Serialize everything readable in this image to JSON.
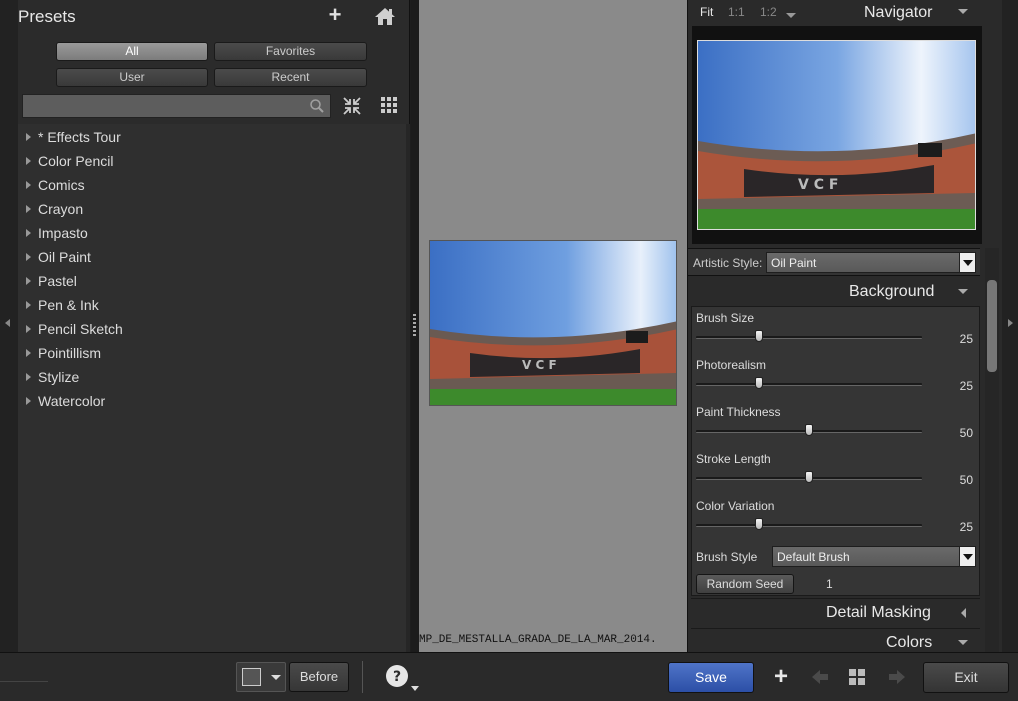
{
  "presets": {
    "title": "Presets",
    "filters": {
      "all": "All",
      "favorites": "Favorites",
      "user": "User",
      "recent": "Recent"
    },
    "search_placeholder": "",
    "items": [
      "* Effects Tour",
      "Color Pencil",
      "Comics",
      "Crayon",
      "Impasto",
      "Oil Paint",
      "Pastel",
      "Pen & Ink",
      "Pencil Sketch",
      "Pointillism",
      "Stylize",
      "Watercolor"
    ]
  },
  "center": {
    "filename": "MP_DE_MESTALLA_GRADA_DE_LA_MAR_2014."
  },
  "navigator": {
    "title": "Navigator",
    "zoom": {
      "fit": "Fit",
      "one_to_one": "1:1",
      "one_to_two": "1:2"
    }
  },
  "artistic_style": {
    "label": "Artistic Style:",
    "value": "Oil Paint"
  },
  "background": {
    "title": "Background",
    "sliders": [
      {
        "label": "Brush Size",
        "value": 25,
        "position": 0.28
      },
      {
        "label": "Photorealism",
        "value": 25,
        "position": 0.28
      },
      {
        "label": "Paint Thickness",
        "value": 50,
        "position": 0.5
      },
      {
        "label": "Stroke Length",
        "value": 50,
        "position": 0.5
      },
      {
        "label": "Color Variation",
        "value": 25,
        "position": 0.28
      }
    ],
    "brush_style": {
      "label": "Brush Style",
      "value": "Default Brush"
    },
    "random_seed": {
      "label": "Random Seed",
      "value": "1"
    }
  },
  "sections": {
    "detail_masking": "Detail Masking",
    "colors": "Colors"
  },
  "toolbar": {
    "before": "Before",
    "save": "Save",
    "exit": "Exit"
  },
  "colors": {
    "save_button": "#3a60bd",
    "active_filter": "#8c8c8c",
    "panel": "#2b2b2b"
  }
}
